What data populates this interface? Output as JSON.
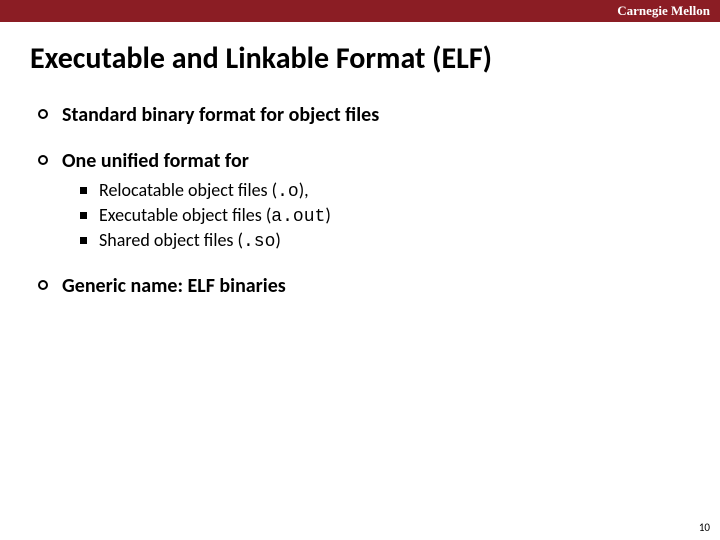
{
  "header": {
    "brand": "Carnegie Mellon"
  },
  "title": "Executable and Linkable Format (ELF)",
  "bullets": [
    {
      "text": "Standard binary format for object files",
      "sub": []
    },
    {
      "text": "One unified format for",
      "sub": [
        {
          "pre": "Relocatable object files (",
          "code": ".o",
          "post": "),"
        },
        {
          "pre": "Executable object files (",
          "code": "a.out",
          "post": ")"
        },
        {
          "pre": "Shared object files (",
          "code": ".so",
          "post": ")"
        }
      ]
    },
    {
      "text": "Generic name: ELF binaries",
      "sub": []
    }
  ],
  "page_number": "10"
}
